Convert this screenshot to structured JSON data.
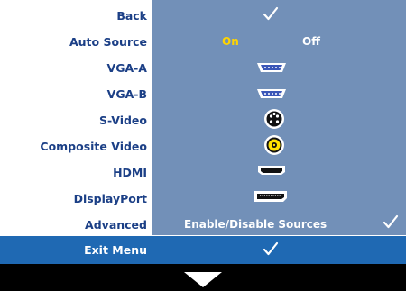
{
  "menu": {
    "back": "Back",
    "auto_source": "Auto Source",
    "auto_on": "On",
    "auto_off": "Off",
    "vga_a": "VGA-A",
    "vga_b": "VGA-B",
    "s_video": "S-Video",
    "composite": "Composite Video",
    "hdmi": "HDMI",
    "displayport": "DisplayPort",
    "advanced": "Advanced",
    "advanced_value": "Enable/Disable Sources",
    "exit": "Exit Menu"
  },
  "colors": {
    "label": "#1b3f86",
    "panel": "#7290b8",
    "selected_option": "#ffd400",
    "exit_bar": "#1f69b3",
    "footer": "#000000"
  },
  "icons": {
    "back": "checkmark-icon",
    "vga_a": "vga-connector-icon",
    "vga_b": "vga-connector-icon",
    "s_video": "s-video-connector-icon",
    "composite": "composite-connector-icon",
    "hdmi": "hdmi-connector-icon",
    "displayport": "displayport-connector-icon",
    "advanced": "checkmark-icon",
    "exit": "checkmark-icon",
    "footer": "down-arrow-icon"
  }
}
